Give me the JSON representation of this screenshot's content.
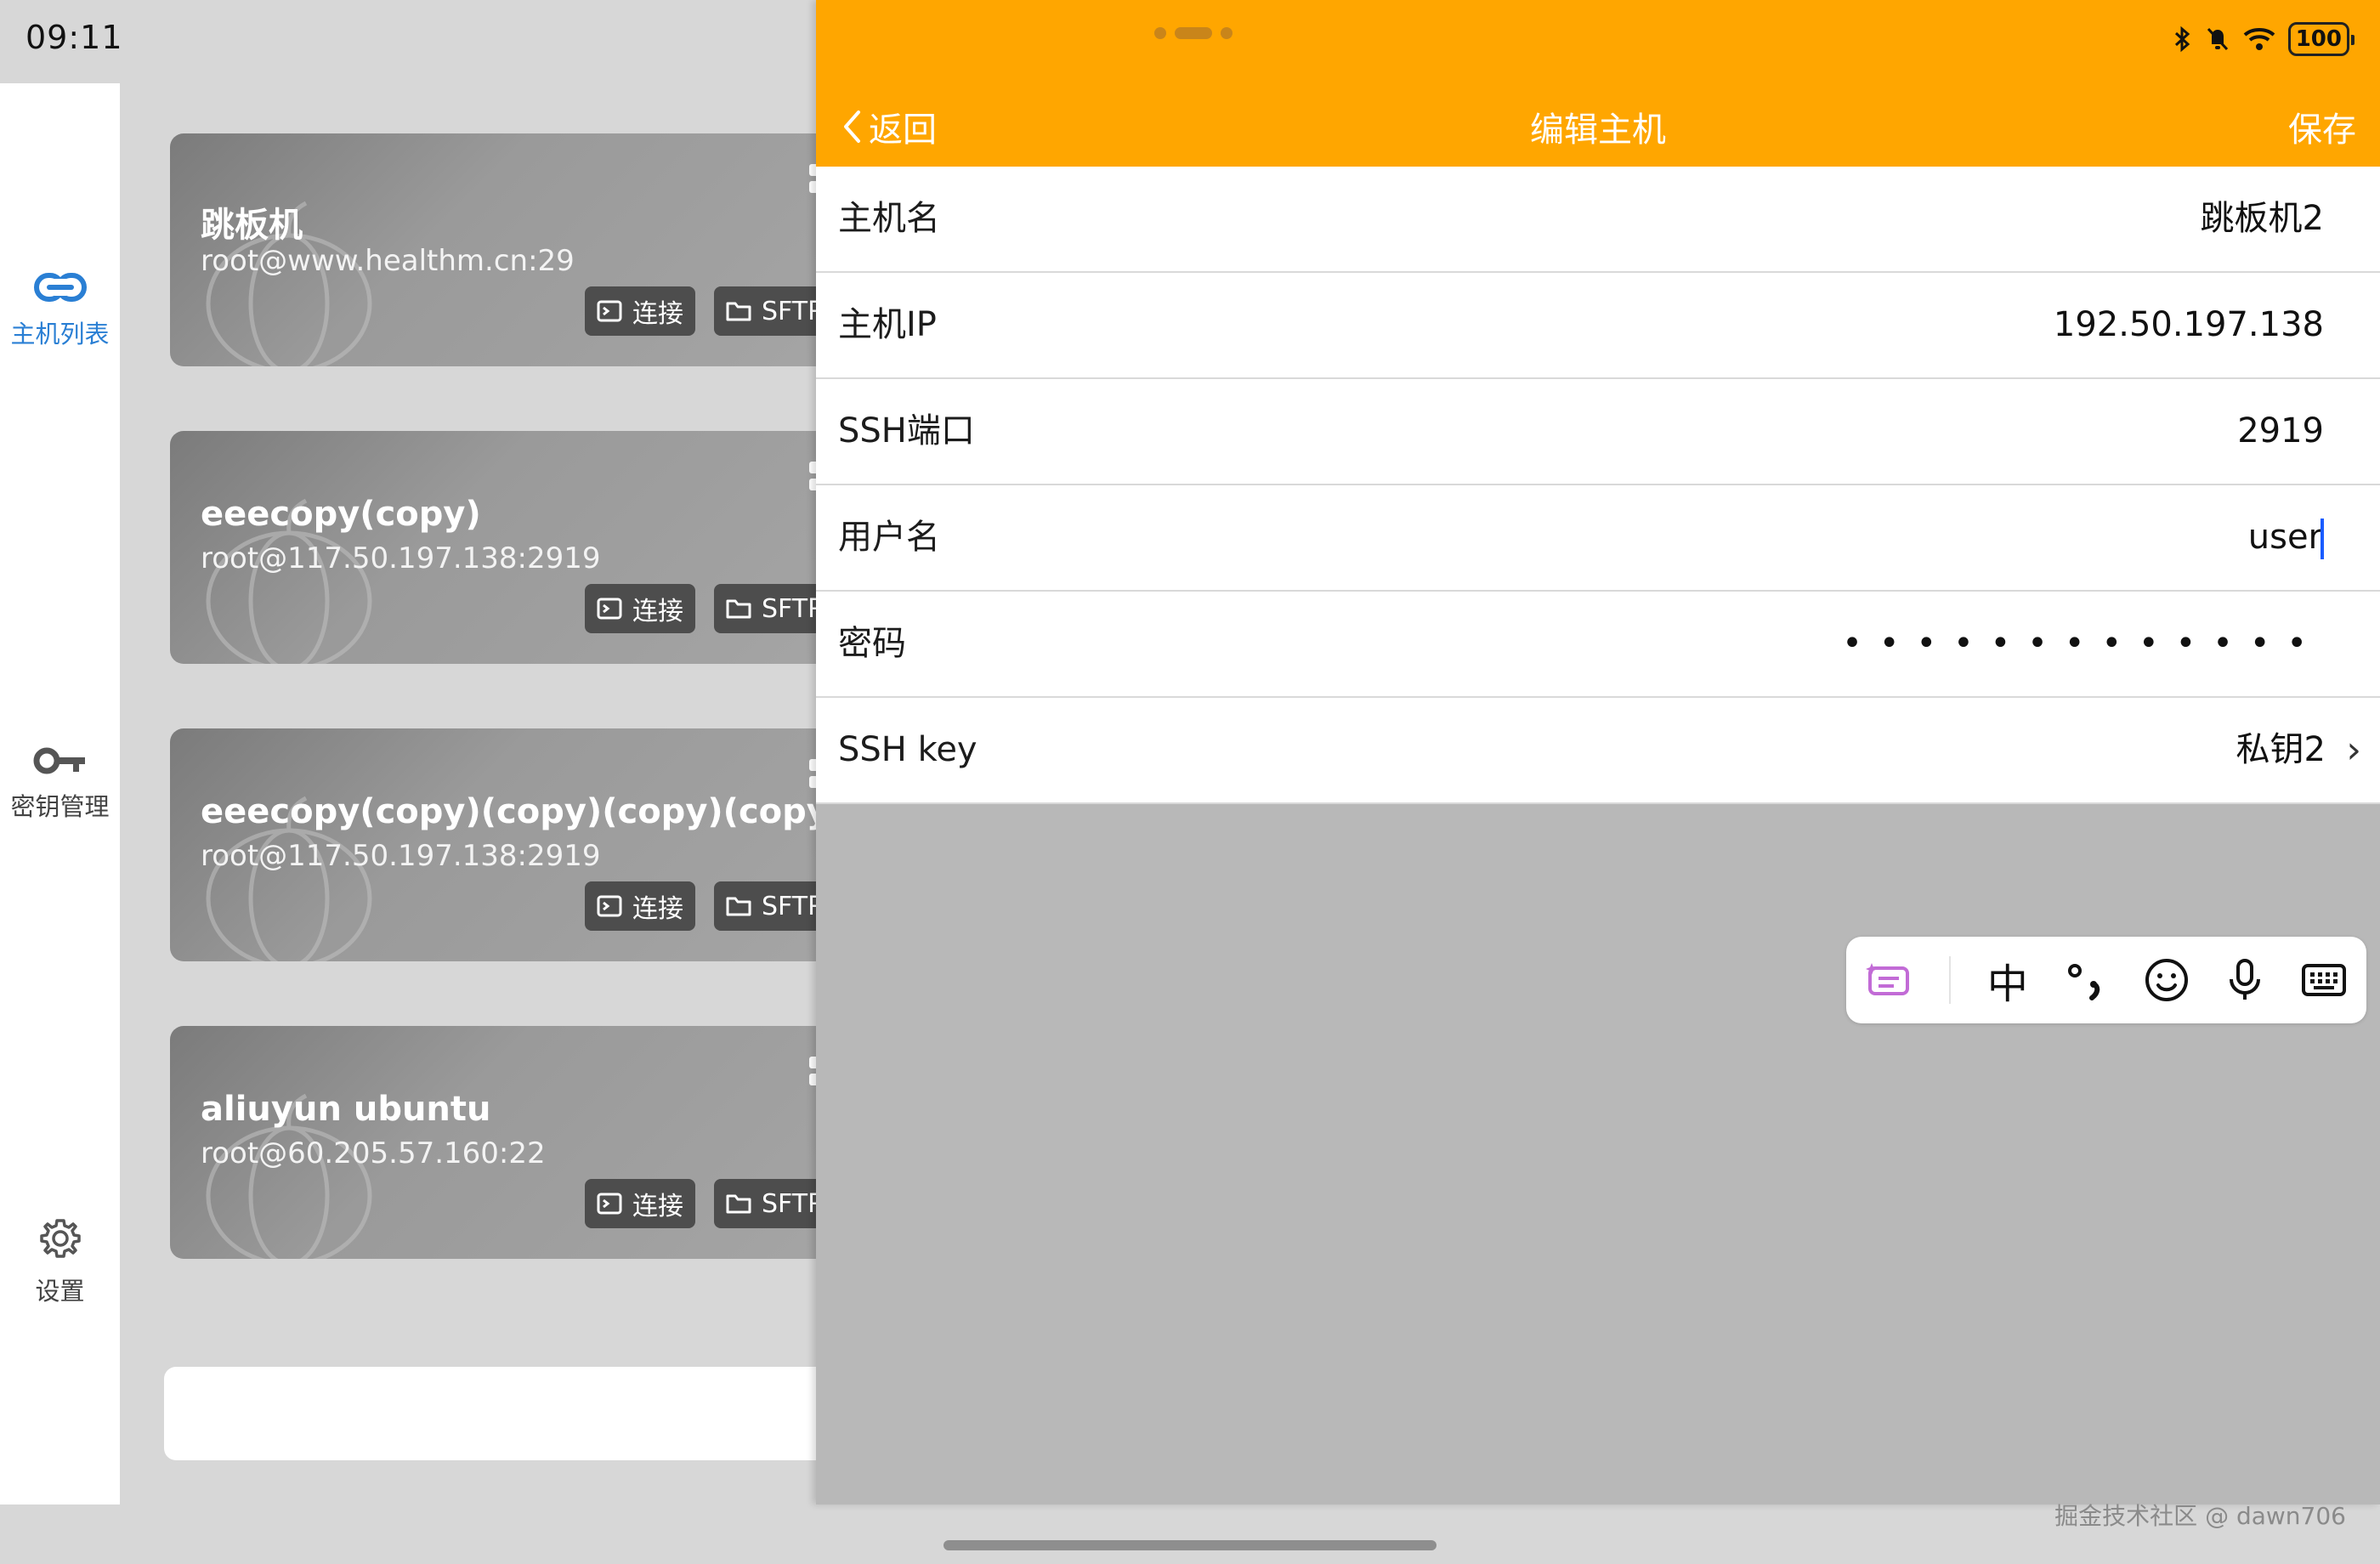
{
  "status": {
    "time": "09:11",
    "battery": "100",
    "icons": [
      "bluetooth-icon",
      "mute-icon",
      "wifi-icon",
      "battery-icon"
    ]
  },
  "sidebar": {
    "items": [
      {
        "label": "主机列表",
        "icon": "link-icon",
        "active": true
      },
      {
        "label": "密钥管理",
        "icon": "key-icon",
        "active": false
      },
      {
        "label": "设置",
        "icon": "gear-icon",
        "active": false
      }
    ]
  },
  "hosts": [
    {
      "name": "跳板机",
      "address": "root@www.healthm.cn:29",
      "connect_label": "连接",
      "sftp_label": "SFTP"
    },
    {
      "name": "eeecopy(copy)",
      "address": "root@117.50.197.138:2919",
      "connect_label": "连接",
      "sftp_label": "SFTP"
    },
    {
      "name": "eeecopy(copy)(copy)(copy)(copy)",
      "address": "root@117.50.197.138:2919",
      "connect_label": "连接",
      "sftp_label": "SFTP"
    },
    {
      "name": "aliuyun ubuntu",
      "address": "root@60.205.57.160:22",
      "connect_label": "连接",
      "sftp_label": "SFTP"
    }
  ],
  "modal": {
    "back_label": "返回",
    "title": "编辑主机",
    "save_label": "保存",
    "fields": {
      "hostname": {
        "label": "主机名",
        "value": "跳板机2"
      },
      "host_ip": {
        "label": "主机IP",
        "value": "192.50.197.138"
      },
      "ssh_port": {
        "label": "SSH端口",
        "value": "2919"
      },
      "username": {
        "label": "用户名",
        "value": "user"
      },
      "password": {
        "label": "密码",
        "value": "•••••••••••••"
      },
      "ssh_key": {
        "label": "SSH key",
        "value": "私钥2"
      }
    }
  },
  "ime": {
    "chinese_label": "中",
    "icons": [
      "ai-keyboard-icon",
      "punctuation-icon",
      "emoji-icon",
      "microphone-icon",
      "keyboard-icon"
    ]
  },
  "watermark": "掘金技术社区 @ dawn706",
  "colors": {
    "accent": "#ffa600",
    "active_nav": "#2a7fd4",
    "caret": "#1a5cff"
  }
}
